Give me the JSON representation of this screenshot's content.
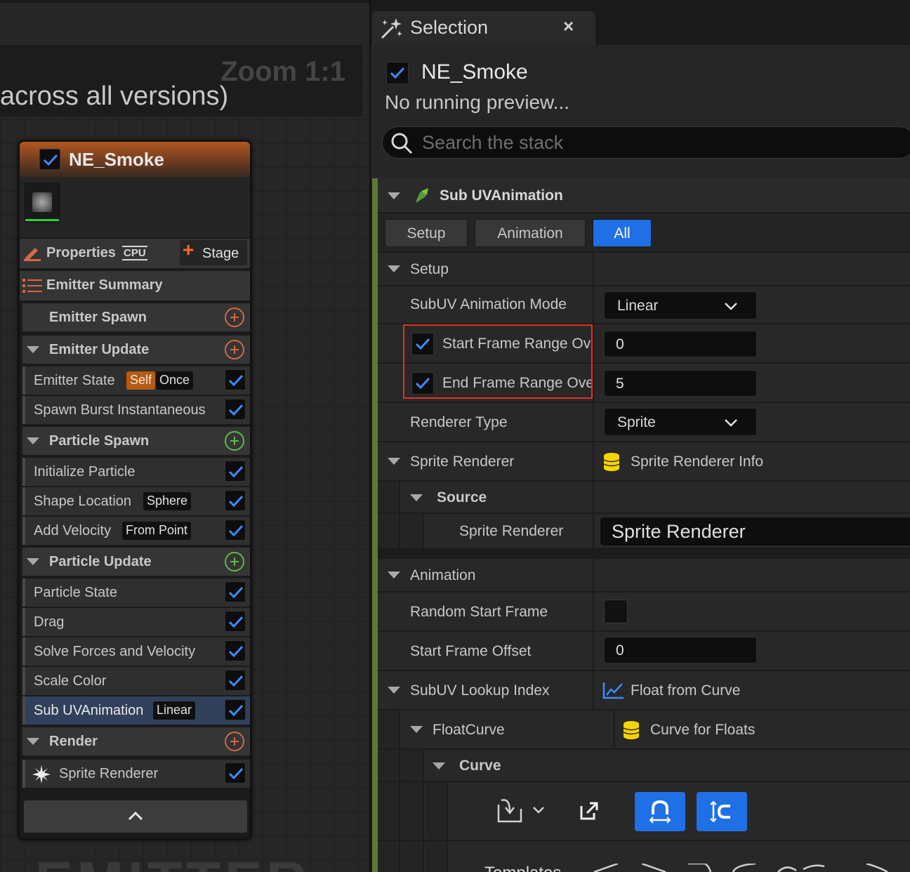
{
  "graph": {
    "zoom": "Zoom 1:1",
    "subtitle": "across all versions)",
    "watermark": "EMITTER"
  },
  "node": {
    "title": "NE_Smoke",
    "properties_label": "Properties",
    "cpu_label": "CPU",
    "stage_label": "Stage",
    "sections": {
      "summary": "Emitter Summary",
      "emitter_spawn": "Emitter Spawn",
      "emitter_update": "Emitter Update",
      "particle_spawn": "Particle Spawn",
      "particle_update": "Particle Update",
      "render": "Render"
    },
    "modules": {
      "emitter_state": {
        "label": "Emitter State",
        "tag1": "Self",
        "tag2": "Once"
      },
      "spawn_burst": {
        "label": "Spawn Burst Instantaneous"
      },
      "init_particle": {
        "label": "Initialize Particle"
      },
      "shape_location": {
        "label": "Shape Location",
        "tag": "Sphere"
      },
      "add_velocity": {
        "label": "Add Velocity",
        "tag": "From Point"
      },
      "particle_state": {
        "label": "Particle State"
      },
      "drag": {
        "label": "Drag"
      },
      "solve_forces": {
        "label": "Solve Forces and Velocity"
      },
      "scale_color": {
        "label": "Scale Color"
      },
      "sub_uv": {
        "label": "Sub UVAnimation",
        "tag": "Linear"
      },
      "sprite_renderer": {
        "label": "Sprite Renderer"
      }
    }
  },
  "panel": {
    "tab_label": "Selection",
    "tab_close": "×",
    "emitter_name": "NE_Smoke",
    "preview_text": "No running preview...",
    "search_placeholder": "Search the stack",
    "module_title": "Sub UVAnimation",
    "filters": {
      "setup": "Setup",
      "animation": "Animation",
      "all": "All"
    },
    "setup": {
      "header": "Setup",
      "mode_label": "SubUV Animation Mode",
      "mode_value": "Linear",
      "start_range_label": "Start Frame Range Ov",
      "start_range_value": "0",
      "end_range_label": "End Frame Range Ove",
      "end_range_value": "5",
      "renderer_type_label": "Renderer Type",
      "renderer_type_value": "Sprite",
      "sprite_renderer_label": "Sprite Renderer",
      "sprite_renderer_value": "Sprite Renderer Info",
      "source_label": "Source",
      "source_sprite_label": "Sprite Renderer",
      "source_sprite_value": "Sprite Renderer"
    },
    "animation": {
      "header": "Animation",
      "random_start_label": "Random Start Frame",
      "start_offset_label": "Start Frame Offset",
      "start_offset_value": "0",
      "lookup_label": "SubUV Lookup Index",
      "lookup_value": "Float from Curve",
      "floatcurve_label": "FloatCurve",
      "floatcurve_value": "Curve for Floats",
      "curve_label": "Curve",
      "templates_label": "Templates"
    }
  },
  "colors": {
    "accent_blue": "#1f6fe6",
    "checkmark_blue": "#3b8cff",
    "highlight_red": "#e0341e",
    "header_orange": "#b2581f",
    "add_orange": "#d06a48",
    "add_green": "#5fb84a"
  }
}
